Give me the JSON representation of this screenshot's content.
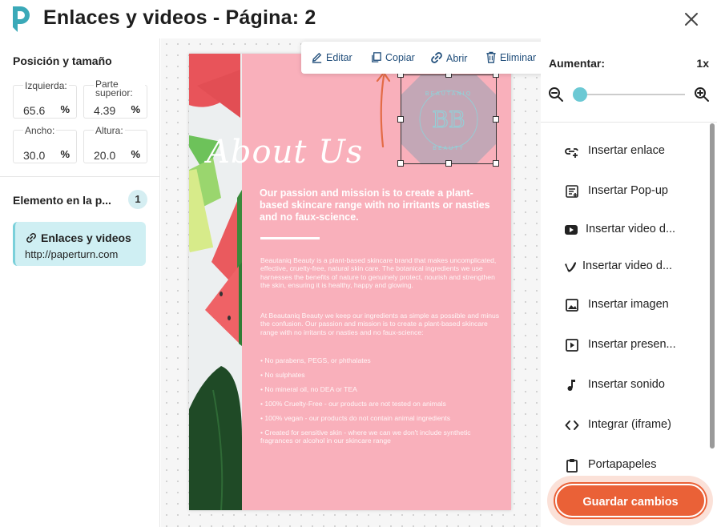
{
  "header": {
    "title": "Enlaces y videos - Página: 2"
  },
  "left": {
    "position_title": "Posición y tamaño",
    "fields": [
      {
        "label": "Izquierda:",
        "value": "65.6",
        "unit": "%"
      },
      {
        "label": "Parte superior:",
        "value": "4.39",
        "unit": "%"
      },
      {
        "label": "Ancho:",
        "value": "30.0",
        "unit": "%"
      },
      {
        "label": "Altura:",
        "value": "20.0",
        "unit": "%"
      }
    ],
    "elements_title": "Elemento en la p...",
    "elements_count": "1",
    "element": {
      "title": "Enlaces y videos",
      "url": "http://paperturn.com"
    }
  },
  "toolbar": {
    "edit": "Editar",
    "copy": "Copiar",
    "open": "Abrir",
    "delete": "Eliminar"
  },
  "page": {
    "heading": "About Us",
    "mission": "Our passion and mission is to create a plant-based skincare range with no irritants or nasties and no faux-science.",
    "para1": "Beautaniq Beauty is a plant-based skincare brand that makes uncomplicated, effective, cruelty-free, natural skin care. The botanical ingredients we use harnesses the benefits of nature to genuinely protect, nourish and strengthen the skin, ensuring it is healthy, happy and glowing.",
    "para2": "At Beautaniq Beauty we keep our ingredients as simple as possible and minus the confusion. Our passion and mission is to create a plant-based skincare range with no irritants or nasties and no faux-science:",
    "bullets": [
      "• No parabens, PEGS, or phthalates",
      "• No sulphates",
      "• No mineral oil, no DEA or TEA",
      "• 100% Cruelty-Free - our products are not tested on animals",
      "• 100% vegan - our products do not contain animal ingredients",
      "• Created for sensitive skin - where we can we don't include synthetic fragrances or alcohol in our skincare range"
    ],
    "logo_top": "BEAUTANIQ",
    "logo_mid": "BB",
    "logo_bottom": "BEAUTY"
  },
  "right": {
    "zoom_label": "Aumentar:",
    "zoom_value": "1x",
    "zoom_level": 0.0,
    "menu": [
      {
        "label": "Insertar enlace",
        "icon": "insert-link-icon"
      },
      {
        "label": "Insertar Pop-up",
        "icon": "popup-icon"
      },
      {
        "label": "Insertar video d...",
        "icon": "youtube-icon"
      },
      {
        "label": "Insertar video d...",
        "icon": "vimeo-icon"
      },
      {
        "label": "Insertar imagen",
        "icon": "image-icon"
      },
      {
        "label": "Insertar presen...",
        "icon": "slideshow-icon"
      },
      {
        "label": "Insertar sonido",
        "icon": "music-note-icon"
      },
      {
        "label": "Integrar (iframe)",
        "icon": "code-icon"
      },
      {
        "label": "Portapapeles",
        "icon": "clipboard-icon"
      }
    ],
    "save": "Guardar cambios"
  },
  "colors": {
    "accent": "#ea6137",
    "teal": "#6cc9d4",
    "page_pink": "#f9b0bb",
    "link_blue": "#1f4d7a"
  }
}
